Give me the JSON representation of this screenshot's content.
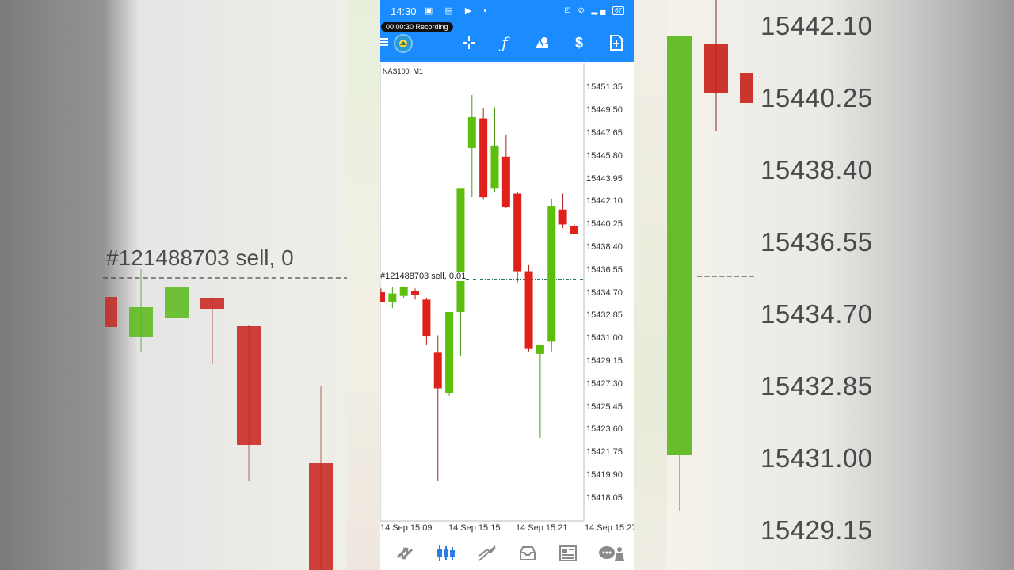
{
  "status_bar": {
    "time": "14:30",
    "battery": "67",
    "recording": "00:00:30  Recording"
  },
  "toolbar": {
    "tools": [
      "crosshair-icon",
      "function-icon",
      "objects-icon",
      "trade-icon",
      "new-order-icon"
    ]
  },
  "chart": {
    "symbol_label": "NAS100, M1",
    "order_line_label": "#121488703 sell, 0.01",
    "order_line_price": 15435.8,
    "colors": {
      "bull": "#5cbf0c",
      "bear": "#e0201a",
      "order_line": "#2b7a5a"
    }
  },
  "chart_data": {
    "type": "candlestick",
    "title": "NAS100, M1",
    "y_ticks": [
      "15451.35",
      "15449.50",
      "15447.65",
      "15445.80",
      "15443.95",
      "15442.10",
      "15440.25",
      "15438.40",
      "15436.55",
      "15434.70",
      "15432.85",
      "15431.00",
      "15429.15",
      "15427.30",
      "15425.45",
      "15423.60",
      "15421.75",
      "15419.90",
      "15418.05"
    ],
    "x_ticks": [
      "14 Sep 15:09",
      "14 Sep 15:15",
      "14 Sep 15:21",
      "14 Sep 15:27"
    ],
    "ylim": [
      15416.3,
      15453.2
    ],
    "candles": [
      {
        "o": 15434.8,
        "h": 15435.1,
        "l": 15434.2,
        "c": 15434.0
      },
      {
        "o": 15434.0,
        "h": 15435.2,
        "l": 15433.5,
        "c": 15434.7
      },
      {
        "o": 15434.5,
        "h": 15435.2,
        "l": 15434.3,
        "c": 15435.2
      },
      {
        "o": 15434.9,
        "h": 15435.1,
        "l": 15434.2,
        "c": 15434.6
      },
      {
        "o": 15434.2,
        "h": 15434.3,
        "l": 15430.5,
        "c": 15431.2
      },
      {
        "o": 15429.9,
        "h": 15431.3,
        "l": 15419.5,
        "c": 15427.0
      },
      {
        "o": 15426.6,
        "h": 15431.8,
        "l": 15426.4,
        "c": 15433.2
      },
      {
        "o": 15433.2,
        "h": 15440.5,
        "l": 15429.6,
        "c": 15443.2
      },
      {
        "o": 15446.5,
        "h": 15450.8,
        "l": 15442.5,
        "c": 15449.0
      },
      {
        "o": 15448.9,
        "h": 15449.7,
        "l": 15442.3,
        "c": 15442.5
      },
      {
        "o": 15443.2,
        "h": 15449.8,
        "l": 15442.9,
        "c": 15446.7
      },
      {
        "o": 15445.8,
        "h": 15447.6,
        "l": 15441.6,
        "c": 15441.7
      },
      {
        "o": 15442.8,
        "h": 15442.9,
        "l": 15435.6,
        "c": 15436.5
      },
      {
        "o": 15436.5,
        "h": 15437.0,
        "l": 15430.0,
        "c": 15430.2
      },
      {
        "o": 15429.8,
        "h": 15430.3,
        "l": 15423.0,
        "c": 15430.5
      },
      {
        "o": 15430.8,
        "h": 15442.4,
        "l": 15430.0,
        "c": 15441.8
      },
      {
        "o": 15441.5,
        "h": 15442.8,
        "l": 15440.0,
        "c": 15440.3
      },
      {
        "o": 15440.2,
        "h": 15440.3,
        "l": 15439.5,
        "c": 15439.5
      }
    ]
  },
  "bottom_nav": [
    "quotes-icon",
    "chart-icon",
    "trade-icon",
    "history-icon",
    "news-icon",
    "messages-icon"
  ],
  "background_prices": [
    "15442.10",
    "15440.25",
    "15438.40",
    "15436.55",
    "15434.70",
    "15432.85",
    "15431.00",
    "15429.15"
  ],
  "background_sell_label": "#121488703 sell, 0"
}
